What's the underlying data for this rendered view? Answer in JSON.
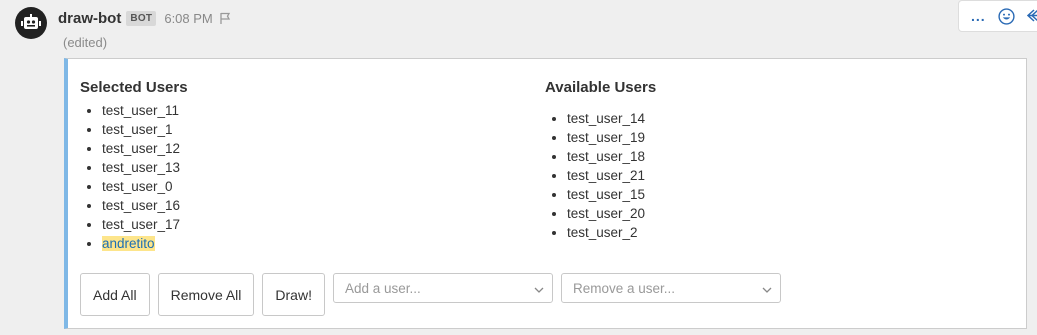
{
  "post": {
    "username": "draw-bot",
    "badge": "BOT",
    "time": "6:08 PM",
    "edited": "(edited)"
  },
  "hover_menu": {
    "more": "...",
    "icons": [
      "emoji-icon",
      "reply-icon"
    ]
  },
  "attachment": {
    "accent_color": "#7fb8e6",
    "selected_title": "Selected Users",
    "selected_users": [
      "test_user_11",
      "test_user_1",
      "test_user_12",
      "test_user_13",
      "test_user_0",
      "test_user_16",
      "test_user_17",
      "andretito"
    ],
    "available_title": "Available Users",
    "available_users": [
      "test_user_14",
      "test_user_19",
      "test_user_18",
      "test_user_21",
      "test_user_15",
      "test_user_20",
      "test_user_2"
    ],
    "buttons": {
      "add_all": "Add All",
      "remove_all": "Remove All",
      "draw": "Draw!"
    },
    "selects": {
      "add_placeholder": "Add a user...",
      "remove_placeholder": "Remove a user..."
    }
  }
}
